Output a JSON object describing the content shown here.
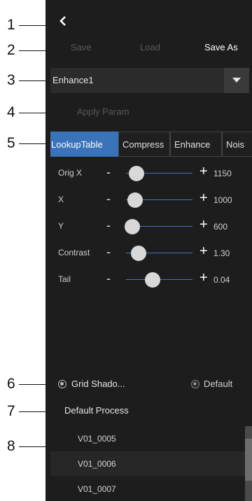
{
  "callouts": [
    "1",
    "2",
    "3",
    "4",
    "5",
    "6",
    "7",
    "8"
  ],
  "toolbar": {
    "save_label": "Save",
    "load_label": "Load",
    "save_as_label": "Save As"
  },
  "preset": {
    "value": "Enhance1"
  },
  "apply_label": "Apply Param",
  "tabs": [
    {
      "label": "LookupTable",
      "active": true
    },
    {
      "label": "Compress",
      "active": false
    },
    {
      "label": "Enhance",
      "active": false
    },
    {
      "label": "Nois",
      "active": false
    }
  ],
  "params": [
    {
      "label": "Orig X",
      "minus": "-",
      "plus": "+",
      "value": "1150",
      "level": 0.16
    },
    {
      "label": "X",
      "minus": "-",
      "plus": "+",
      "value": "1000",
      "level": 0.14
    },
    {
      "label": "Y",
      "minus": "-",
      "plus": "+",
      "value": "600",
      "level": 0.09
    },
    {
      "label": "Contrast",
      "minus": "-",
      "plus": "+",
      "value": "1.30",
      "level": 0.19
    },
    {
      "label": "Tail",
      "minus": "-",
      "plus": "+",
      "value": "0.04",
      "level": 0.4
    }
  ],
  "options": {
    "grid_label": "Grid Shado...",
    "default_label": "Default"
  },
  "process": {
    "title": "Default Process",
    "items": [
      "V01_0005",
      "V01_0006",
      "V01_0007"
    ]
  },
  "colors": {
    "accent": "#3b73b9",
    "panel": "#1d1d1d"
  },
  "icons": {
    "back": "chevron-left-icon",
    "dropdown": "caret-down-icon"
  }
}
